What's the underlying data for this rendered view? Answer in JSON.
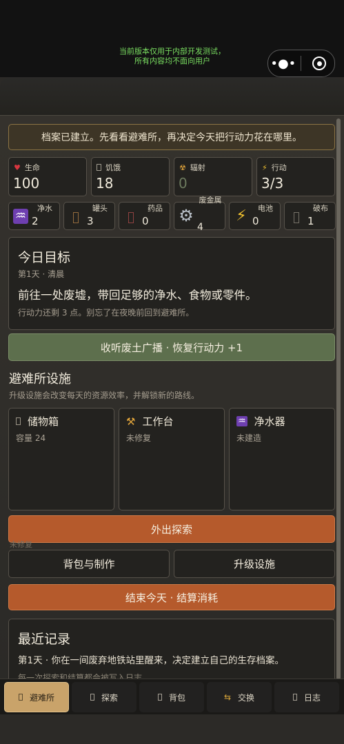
{
  "system": {
    "banner_line1": "当前版本仅用于内部开发测试，",
    "banner_line2": "所有内容均不面向用户",
    "menu_icon": "more-dots-icon",
    "close_icon": "target-icon"
  },
  "notice": "档案已建立。先看看避难所，再决定今天把行动力花在哪里。",
  "stats": [
    {
      "label": "生命",
      "value": "100",
      "icon": "heart-icon",
      "color": "#d8363f"
    },
    {
      "label": "饥饿",
      "value": "18",
      "icon": "food-icon",
      "color": "#cfc6b4"
    },
    {
      "label": "辐射",
      "value": "0",
      "icon": "radiation-icon",
      "color": "#e0a43b"
    },
    {
      "label": "行动",
      "value": "3/3",
      "icon": "lightning-icon",
      "color": "#f2c230"
    }
  ],
  "resources": [
    {
      "label": "净水",
      "value": "2",
      "icon": "water-icon",
      "glyph": "♒"
    },
    {
      "label": "罐头",
      "value": "3",
      "icon": "can-icon",
      "glyph": ""
    },
    {
      "label": "药品",
      "value": "0",
      "icon": "medicine-icon",
      "glyph": ""
    },
    {
      "label": "废金属",
      "value": "4",
      "icon": "gear-icon",
      "glyph": "⚙"
    },
    {
      "label": "电池",
      "value": "0",
      "icon": "battery-icon",
      "glyph": "⚡"
    },
    {
      "label": "破布",
      "value": "1",
      "icon": "cloth-icon",
      "glyph": ""
    }
  ],
  "goal": {
    "title": "今日目标",
    "day": "第1天 · 清晨",
    "text": "前往一处废墟，带回足够的净水、食物或零件。",
    "hint": "行动力还剩 3 点。别忘了在夜晚前回到避难所。"
  },
  "radio_button": "收听废土广播 · 恢复行动力 +1",
  "facilities": {
    "title": "避难所设施",
    "subtitle": "升级设施会改变每天的资源效率，并解锁新的路线。",
    "items": [
      {
        "name": "储物箱",
        "status": "容量 24",
        "icon": "box-icon",
        "glyph": ""
      },
      {
        "name": "工作台",
        "status": "未修复",
        "icon": "tools-icon",
        "glyph": "⚒"
      },
      {
        "name": "净水器",
        "status": "未建造",
        "icon": "water-icon",
        "glyph": "♒"
      }
    ]
  },
  "actions": {
    "explore": "外出探索",
    "partial_text": "未修复",
    "backpack_craft": "背包与制作",
    "upgrade": "升级设施",
    "end_day": "结束今天 · 结算消耗"
  },
  "log": {
    "title": "最近记录",
    "entry": "第1天 · 你在一间废弃地铁站里醒来，决定建立自己的生存档案。",
    "faded": "每一次探索和结算都会被写入日志。"
  },
  "tabs": [
    {
      "label": "避难所",
      "icon": "shelter-icon",
      "active": true
    },
    {
      "label": "探索",
      "icon": "compass-icon",
      "active": false
    },
    {
      "label": "背包",
      "icon": "backpack-icon",
      "active": false
    },
    {
      "label": "交换",
      "icon": "trade-icon",
      "active": false
    },
    {
      "label": "日志",
      "icon": "book-icon",
      "active": false
    }
  ]
}
